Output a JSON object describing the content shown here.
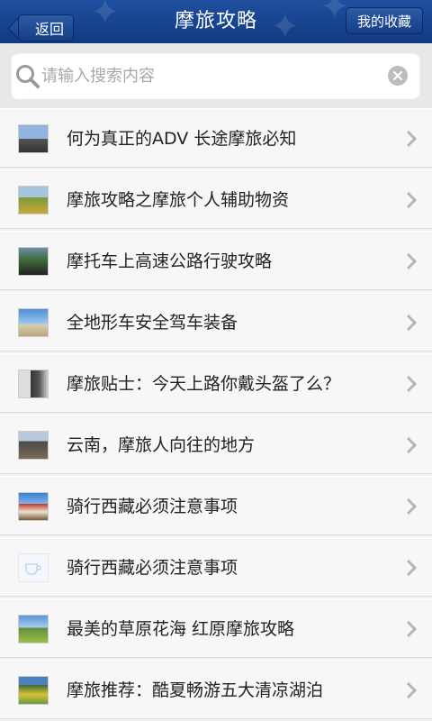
{
  "header": {
    "back_label": "返回",
    "title": "摩旅攻略",
    "favorites_label": "我的收藏",
    "bar_color": "#1a4894"
  },
  "search": {
    "placeholder": "请输入搜索内容",
    "value": ""
  },
  "articles": [
    {
      "title": "何为真正的ADV 长途摩旅必知",
      "thumb": "motorcycle-road-photo"
    },
    {
      "title": "摩旅攻略之摩旅个人辅助物资",
      "thumb": "grassland-photo"
    },
    {
      "title": "摩托车上高速公路行驶攻略",
      "thumb": "highway-riders-photo"
    },
    {
      "title": "全地形车安全驾车装备",
      "thumb": "sky-landscape-photo"
    },
    {
      "title": "摩旅贴士：今天上路你戴头盔了么？",
      "thumb": "rider-helmet-photo"
    },
    {
      "title": "云南，摩旅人向往的地方",
      "thumb": "crowd-photo"
    },
    {
      "title": "骑行西藏必须注意事项",
      "thumb": "tibet-building-photo"
    },
    {
      "title": "骑行西藏必须注意事项",
      "thumb": "placeholder-cup-image"
    },
    {
      "title": "最美的草原花海 红原摩旅攻略",
      "thumb": "grassland-sky-photo"
    },
    {
      "title": "摩旅推荐：酷夏畅游五大清凉湖泊",
      "thumb": "lake-fields-photo"
    }
  ]
}
